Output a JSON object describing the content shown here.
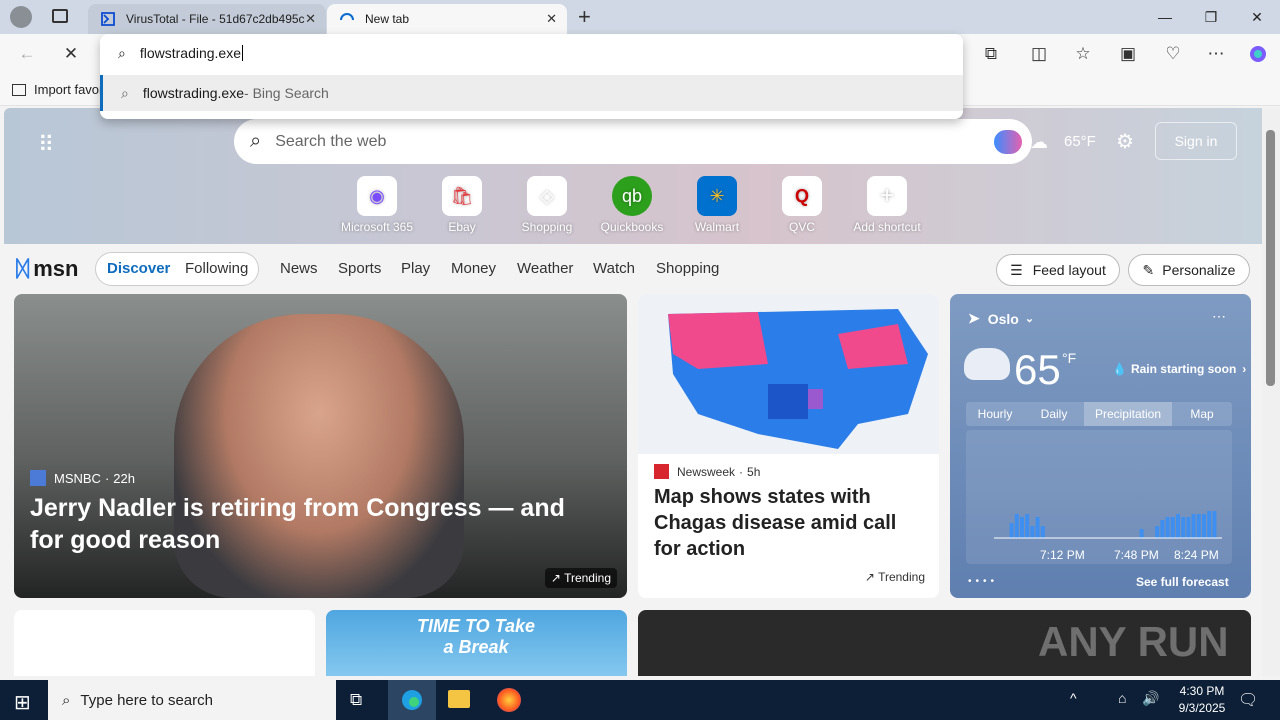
{
  "tabs": [
    {
      "title": "VirusTotal - File - 51d67c2db495c"
    },
    {
      "title": "New tab"
    }
  ],
  "address": {
    "typed": "flowstrading.exe",
    "suggestion": "flowstrading.exe",
    "suggestion_suffix": " - Bing Search"
  },
  "favbar": {
    "import": "Import favor"
  },
  "msn": {
    "search_placeholder": "Search the web",
    "temp": "65°F",
    "sign_in": "Sign in",
    "shortcuts": [
      "Microsoft 365",
      "Ebay",
      "Shopping",
      "Quickbooks",
      "Walmart",
      "QVC",
      "Add shortcut"
    ],
    "logo": "msn",
    "discover": "Discover",
    "following": "Following",
    "nav": [
      "News",
      "Sports",
      "Play",
      "Money",
      "Weather",
      "Watch",
      "Shopping"
    ],
    "feed_layout": "Feed layout",
    "personalize": "Personalize"
  },
  "cards": {
    "main": {
      "source": "MSNBC",
      "age": "22h",
      "title": "Jerry Nadler is retiring from Congress — and for good reason",
      "badge": "Trending"
    },
    "second": {
      "source": "Newsweek",
      "age": "5h",
      "title": "Map shows states with Chagas disease amid call for action",
      "badge": "Trending"
    },
    "promo": {
      "text": "TIME TO Take a Break"
    },
    "watermark": "ANY RUN"
  },
  "weather": {
    "city": "Oslo",
    "temp": "65",
    "unit": "°F",
    "alert": "Rain starting soon",
    "tabs": [
      "Hourly",
      "Daily",
      "Precipitation",
      "Map"
    ],
    "active_tab": "Precipitation",
    "times": [
      "7:12 PM",
      "7:48 PM",
      "8:24 PM"
    ],
    "link": "See full forecast",
    "bars": [
      0,
      0,
      0,
      0.5,
      0.8,
      0.7,
      0.8,
      0.4,
      0.7,
      0.4,
      0,
      0,
      0,
      0,
      0,
      0,
      0,
      0,
      0,
      0,
      0,
      0,
      0,
      0,
      0,
      0,
      0,
      0,
      0.3,
      0,
      0,
      0.4,
      0.6,
      0.7,
      0.7,
      0.8,
      0.7,
      0.7,
      0.8,
      0.8,
      0.8,
      0.9,
      0.9
    ]
  },
  "taskbar": {
    "search": "Type here to search",
    "time": "4:30 PM",
    "date": "9/3/2025"
  }
}
